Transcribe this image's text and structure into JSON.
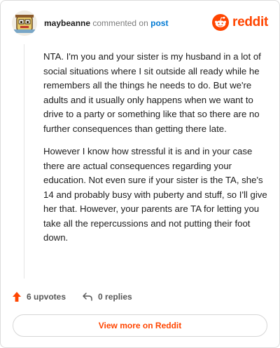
{
  "comment": {
    "username": "maybeanne",
    "action_text": "commented on",
    "target_text": "post",
    "paragraphs": [
      "NTA. I'm you and your sister is my husband in a lot of social situations where I sit outside all ready while he remembers all the things he needs to do. But we're adults and it usually only happens when we want to drive to a party or something like that so there are no further consequences than getting there late.",
      "However I know how stressful it is and in your case there are actual consequences regarding your education. Not even sure if your sister is the TA, she's 14 and probably busy with puberty and stuff, so I'll give her that. However, your parents are TA for letting you take all the repercussions and not putting their foot down."
    ]
  },
  "brand": {
    "name": "reddit",
    "icon": "reddit-logo-icon",
    "color": "#ff4500"
  },
  "footer": {
    "upvotes": "6 upvotes",
    "replies": "0 replies",
    "upvote_icon": "upvote-arrow-icon",
    "reply_icon": "reply-arrow-icon"
  },
  "cta": {
    "label": "View more on Reddit"
  }
}
